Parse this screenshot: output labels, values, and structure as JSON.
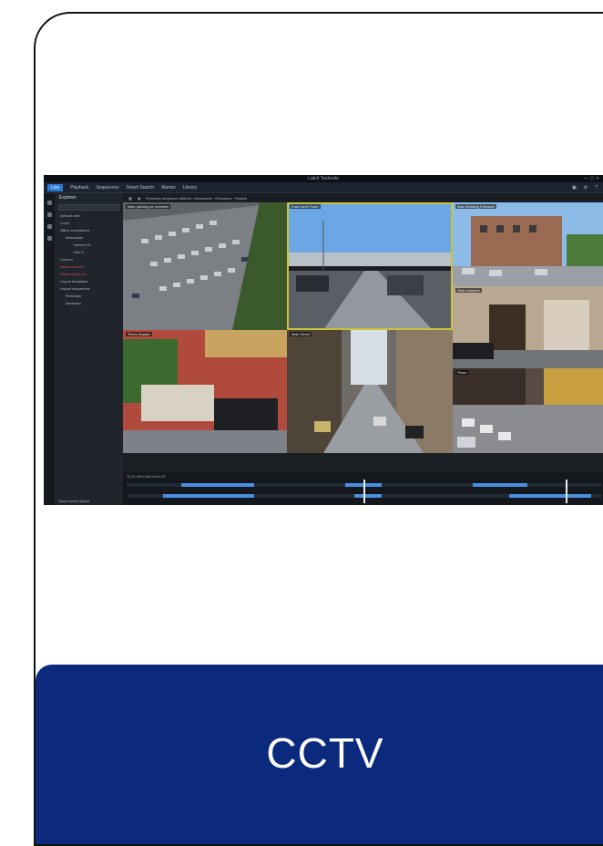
{
  "banner": {
    "label": "CCTV"
  },
  "app": {
    "title": "Latch Technolo",
    "menu": [
      "Live",
      "Playback",
      "Sequences",
      "Smart Search",
      "Alarms",
      "Library"
    ],
    "active_menu": "Live",
    "toolbar_path": "Perimeter sequence defined › Mezzanine · Entrances · Parade",
    "sidebar": {
      "heading": "Explorer",
      "items": [
        {
          "label": "Default view",
          "level": 1,
          "red": false
        },
        {
          "label": "Local",
          "level": 1,
          "red": false
        },
        {
          "label": "Office surveillance",
          "level": 1,
          "red": false
        },
        {
          "label": "Mezzanine",
          "level": 2,
          "red": false
        },
        {
          "label": "Camera 01",
          "level": 3,
          "red": false
        },
        {
          "label": "Cam 5",
          "level": 3,
          "red": false
        },
        {
          "label": "Custom",
          "level": 1,
          "red": false
        },
        {
          "label": "Alarm sources",
          "level": 1,
          "red": true
        },
        {
          "label": "Alarm sequence",
          "level": 1,
          "red": true
        },
        {
          "label": "Layout templates",
          "level": 1,
          "red": false
        },
        {
          "label": "Layout sequences",
          "level": 1,
          "red": false
        },
        {
          "label": "Perimeter",
          "level": 2,
          "red": false
        },
        {
          "label": "Backyard",
          "level": 2,
          "red": false
        }
      ],
      "footer": "Save current layout"
    },
    "cameras": [
      {
        "label": "Main parking lot overview"
      },
      {
        "label": "East North Road"
      },
      {
        "label": "Main Building Entrance"
      },
      {
        "label": "Side entrance"
      },
      {
        "label": "Times Square"
      },
      {
        "label": "Main Street"
      },
      {
        "label": "Plaza"
      }
    ],
    "timeline": {
      "date": "12.11.2019  08:04:43.10"
    }
  },
  "colors": {
    "banner": "#0b2a7d",
    "accent": "#2b7bd6",
    "selection": "#c8c33a"
  }
}
